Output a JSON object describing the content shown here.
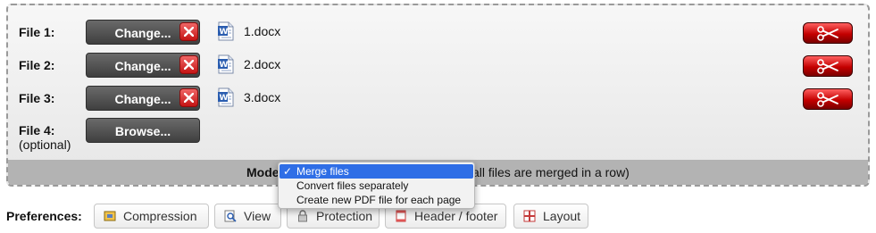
{
  "files": [
    {
      "label": "File 1:",
      "sublabel": "",
      "button": "Change...",
      "filename": "1.docx"
    },
    {
      "label": "File 2:",
      "sublabel": "",
      "button": "Change...",
      "filename": "2.docx"
    },
    {
      "label": "File 3:",
      "sublabel": "",
      "button": "Change...",
      "filename": "3.docx"
    },
    {
      "label": "File 4:",
      "sublabel": "(optional)",
      "button": "Browse...",
      "filename": ""
    }
  ],
  "mode": {
    "label": "Mode",
    "description": "all files are merged in a row)",
    "options": [
      "Merge files",
      "Convert files separately",
      "Create new PDF file for each page"
    ],
    "selected": "Merge files",
    "check": "✓"
  },
  "preferences": {
    "label": "Preferences:",
    "tabs": [
      "Compression",
      "View",
      "Protection",
      "Header / footer",
      "Layout"
    ]
  },
  "icons": {
    "file_icon": "word-document-icon",
    "delete_icon": "close-icon",
    "split_icon": "scissors-icon",
    "colors": {
      "delete": "#d42020",
      "split": "#c40000",
      "selected_option": "#2f6ee6"
    }
  }
}
